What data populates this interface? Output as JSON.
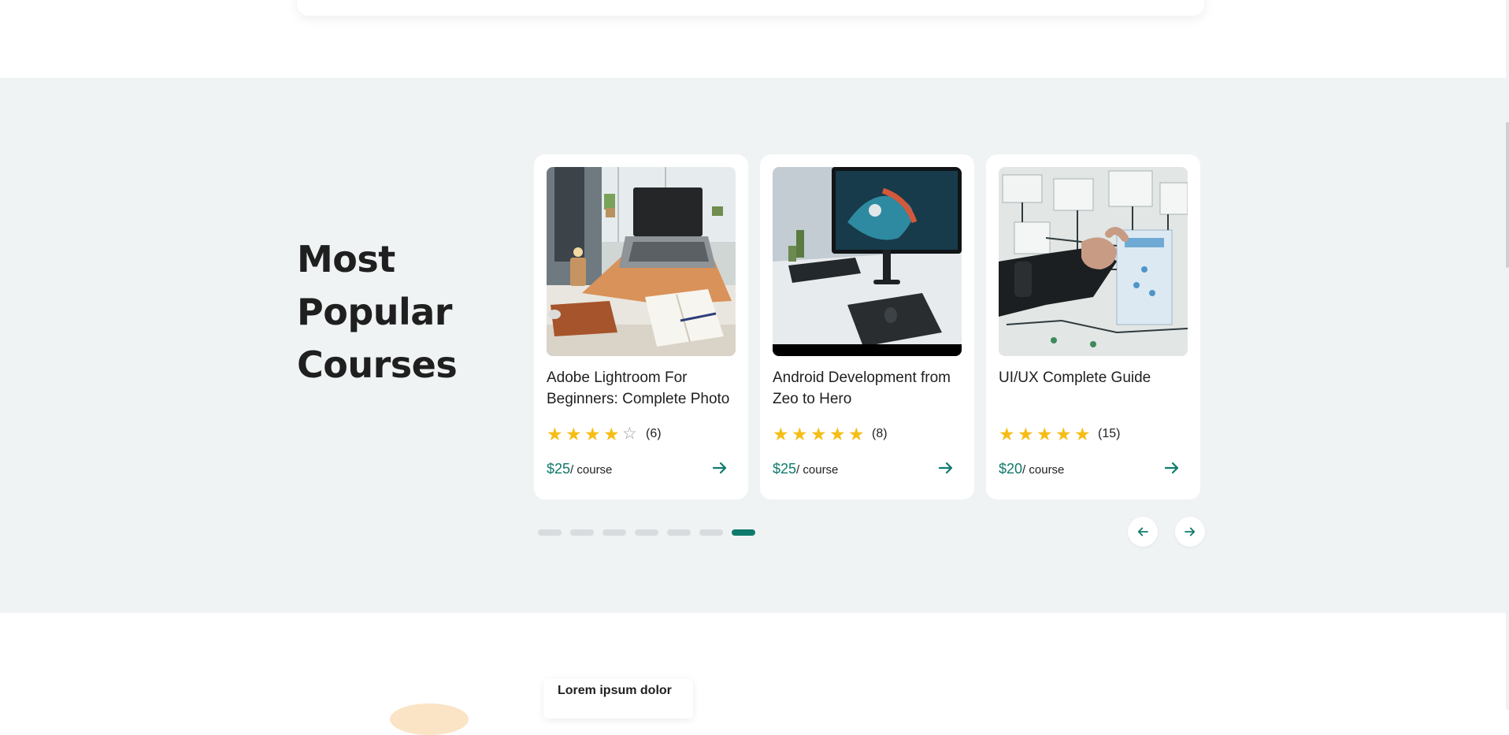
{
  "section": {
    "heading": [
      "Most",
      "Popular",
      "Courses"
    ]
  },
  "courses": [
    {
      "title": "Adobe Lightroom For Beginners: Complete Photo",
      "rating": 4,
      "max_rating": 5,
      "rating_count": "(6)",
      "price": "$25",
      "price_unit": "/ course",
      "image": "laptop-desk-photo"
    },
    {
      "title": "Android Development from Zeo to Hero",
      "rating": 5,
      "max_rating": 5,
      "rating_count": "(8)",
      "price": "$25",
      "price_unit": "/ course",
      "image": "monitor-desk-photo"
    },
    {
      "title": "UI/UX Complete Guide",
      "rating": 5,
      "max_rating": 5,
      "rating_count": "(15)",
      "price": "$20",
      "price_unit": "/ course",
      "image": "wireframe-board-photo"
    }
  ],
  "carousel": {
    "page_count": 7,
    "active_index": 6,
    "prev_icon": "arrow-left-icon",
    "next_icon": "arrow-right-icon"
  },
  "bottom": {
    "card_text": "Lorem ipsum dolor"
  },
  "colors": {
    "accent": "#0f7b6c",
    "star": "#f6bd16",
    "section_bg": "#f0f3f4"
  }
}
